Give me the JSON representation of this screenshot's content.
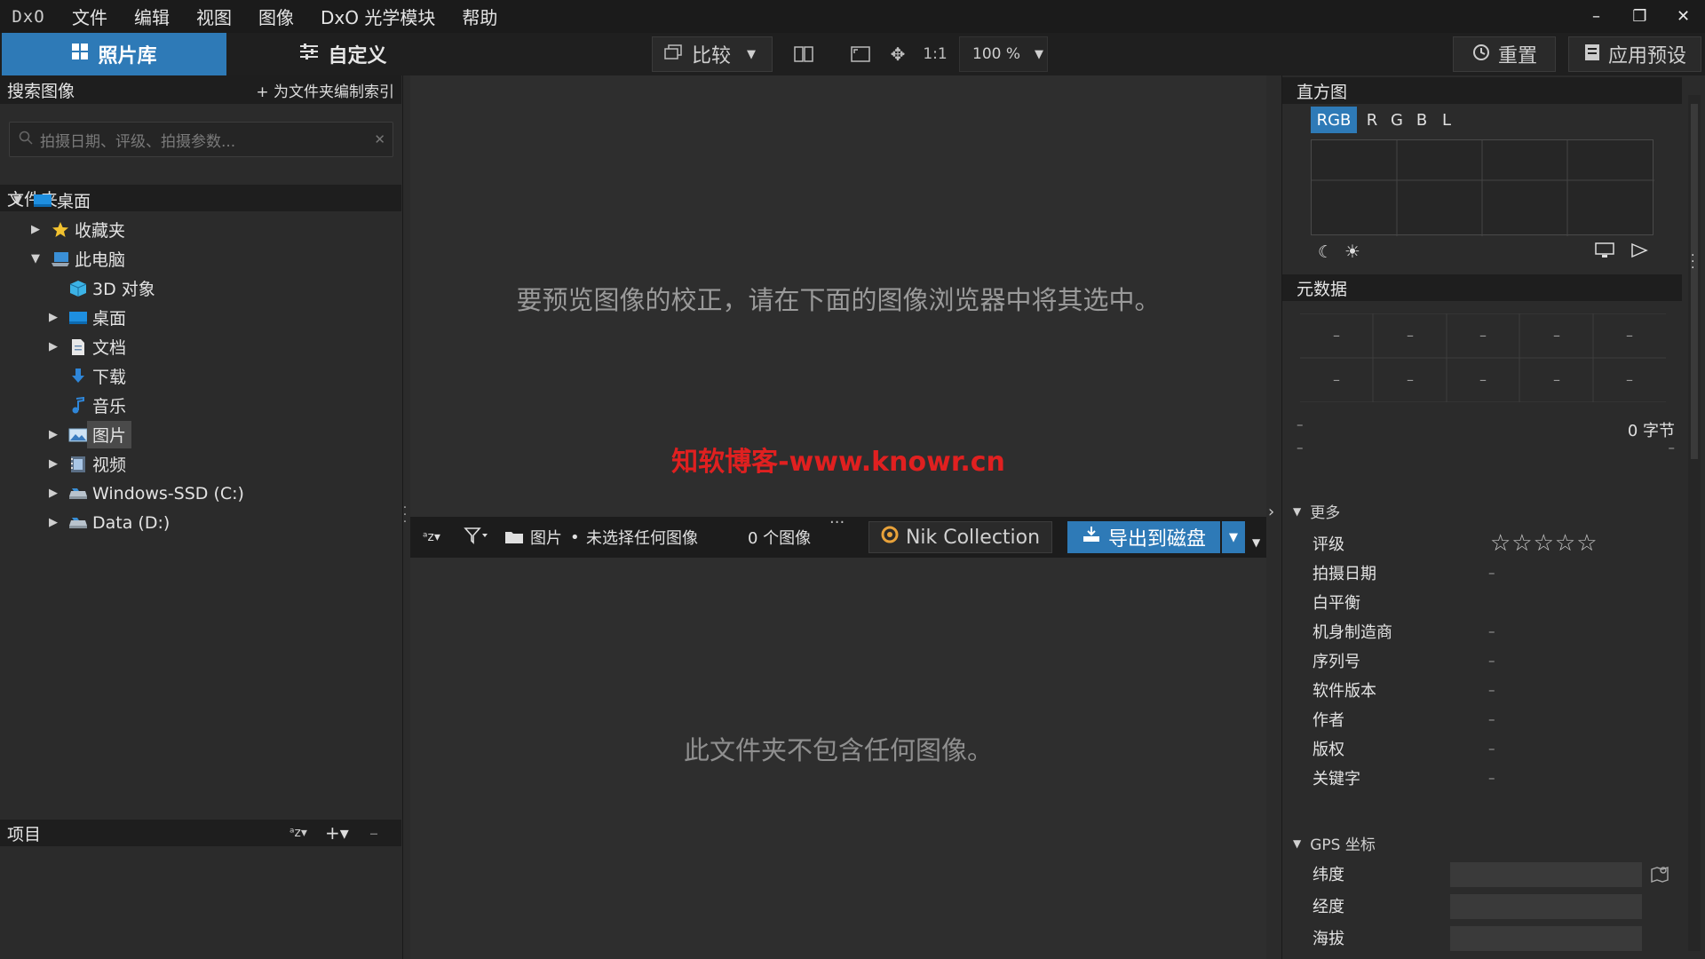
{
  "menubar": {
    "logo": "DxO",
    "items": [
      "文件",
      "编辑",
      "视图",
      "图像",
      "DxO 光学模块",
      "帮助"
    ]
  },
  "toolbar": {
    "tab_library": "照片库",
    "tab_customize": "自定义",
    "compare_label": "比较",
    "one_to_one": "1:1",
    "zoom": "100 %",
    "reset_label": "重置",
    "apply_preset_label": "应用预设"
  },
  "left": {
    "search_title": "搜索图像",
    "index_label": "+ 为文件夹编制索引",
    "search_placeholder": "拍摄日期、评级、拍摄参数...",
    "folders_title": "文件夹",
    "tree": [
      {
        "label": "桌面",
        "arrow": "▼",
        "icon": "desktop-icon"
      },
      {
        "label": "收藏夹",
        "arrow": "▶",
        "icon": "star-icon"
      },
      {
        "label": "此电脑",
        "arrow": "▼",
        "icon": "computer-icon"
      },
      {
        "label": "3D 对象",
        "arrow": "",
        "icon": "cube-icon"
      },
      {
        "label": "桌面",
        "arrow": "▶",
        "icon": "desktop-icon"
      },
      {
        "label": "文档",
        "arrow": "▶",
        "icon": "document-icon"
      },
      {
        "label": "下载",
        "arrow": "",
        "icon": "download-icon"
      },
      {
        "label": "音乐",
        "arrow": "",
        "icon": "music-icon"
      },
      {
        "label": "图片",
        "arrow": "▶",
        "icon": "pictures-icon"
      },
      {
        "label": "视频",
        "arrow": "▶",
        "icon": "video-icon"
      },
      {
        "label": "Windows-SSD (C:)",
        "arrow": "▶",
        "icon": "drive-icon"
      },
      {
        "label": "Data (D:)",
        "arrow": "▶",
        "icon": "drive-icon"
      }
    ],
    "projects_title": "项目"
  },
  "center": {
    "preview_message": "要预览图像的校正，请在下面的图像浏览器中将其选中。",
    "watermark": "知软博客-www.knowr.cn",
    "folder_name": "图片",
    "selection_status": "未选择任何图像",
    "image_count": "0 个图像",
    "nik_collection": "Nik Collection",
    "export_label": "导出到磁盘",
    "empty_message": "此文件夹不包含任何图像。"
  },
  "right": {
    "histogram_title": "直方图",
    "channels": [
      "RGB",
      "R",
      "G",
      "B",
      "L"
    ],
    "metadata_title": "元数据",
    "meta_cells": [
      "–",
      "–",
      "–",
      "–",
      "–",
      "–",
      "–",
      "–",
      "–",
      "–"
    ],
    "size_left": "–",
    "file_size": "0 字节",
    "dash_left": "–",
    "dash_right": "–",
    "more_title": "更多",
    "properties": [
      {
        "label": "评级",
        "value": "☆☆☆☆☆"
      },
      {
        "label": "拍摄日期",
        "value": "–"
      },
      {
        "label": "白平衡",
        "value": ""
      },
      {
        "label": "机身制造商",
        "value": "–"
      },
      {
        "label": "序列号",
        "value": "–"
      },
      {
        "label": "软件版本",
        "value": "–"
      },
      {
        "label": "作者",
        "value": "–"
      },
      {
        "label": "版权",
        "value": "–"
      },
      {
        "label": "关键字",
        "value": "–"
      }
    ],
    "gps_title": "GPS 坐标",
    "gps_fields": [
      "纬度",
      "经度",
      "海拔"
    ]
  },
  "colors": {
    "accent": "#2e7ab7",
    "watermark": "#e02020"
  }
}
